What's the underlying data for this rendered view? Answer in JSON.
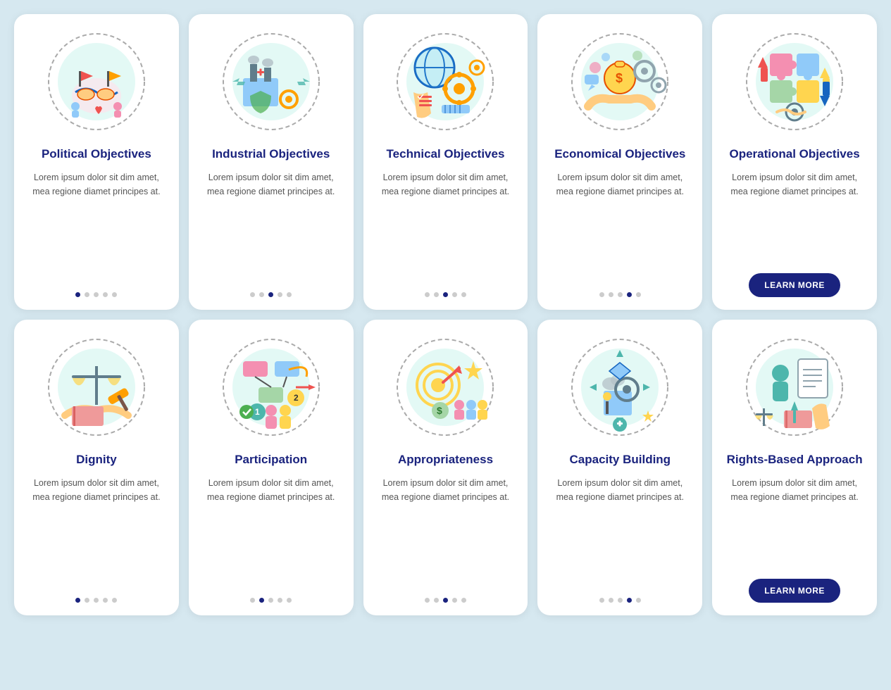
{
  "cards": [
    {
      "id": "political-objectives",
      "title": "Political Objectives",
      "body": "Lorem ipsum dolor sit dim amet, mea regione diamet principes at.",
      "dots": [
        1,
        0,
        0,
        0,
        0
      ],
      "hasButton": false,
      "icon": "political"
    },
    {
      "id": "industrial-objectives",
      "title": "Industrial Objectives",
      "body": "Lorem ipsum dolor sit dim amet, mea regione diamet principes at.",
      "dots": [
        0,
        0,
        1,
        0,
        0
      ],
      "hasButton": false,
      "icon": "industrial"
    },
    {
      "id": "technical-objectives",
      "title": "Technical Objectives",
      "body": "Lorem ipsum dolor sit dim amet, mea regione diamet principes at.",
      "dots": [
        0,
        0,
        1,
        0,
        0
      ],
      "hasButton": false,
      "icon": "technical"
    },
    {
      "id": "economical-objectives",
      "title": "Economical Objectives",
      "body": "Lorem ipsum dolor sit dim amet, mea regione diamet principes at.",
      "dots": [
        0,
        0,
        0,
        1,
        0
      ],
      "hasButton": false,
      "icon": "economical"
    },
    {
      "id": "operational-objectives",
      "title": "Operational Objectives",
      "body": "Lorem ipsum dolor sit dim amet, mea regione diamet principes at.",
      "dots": null,
      "hasButton": true,
      "buttonLabel": "LEARN MORE",
      "icon": "operational"
    },
    {
      "id": "dignity",
      "title": "Dignity",
      "body": "Lorem ipsum dolor sit dim amet, mea regione diamet principes at.",
      "dots": [
        1,
        0,
        0,
        0,
        0
      ],
      "hasButton": false,
      "icon": "dignity"
    },
    {
      "id": "participation",
      "title": "Participation",
      "body": "Lorem ipsum dolor sit dim amet, mea regione diamet principes at.",
      "dots": [
        0,
        1,
        0,
        0,
        0
      ],
      "hasButton": false,
      "icon": "participation"
    },
    {
      "id": "appropriateness",
      "title": "Appropriateness",
      "body": "Lorem ipsum dolor sit dim amet, mea regione diamet principes at.",
      "dots": [
        0,
        0,
        1,
        0,
        0
      ],
      "hasButton": false,
      "icon": "appropriateness"
    },
    {
      "id": "capacity-building",
      "title": "Capacity Building",
      "body": "Lorem ipsum dolor sit dim amet, mea regione diamet principes at.",
      "dots": [
        0,
        0,
        0,
        1,
        0
      ],
      "hasButton": false,
      "icon": "capacity"
    },
    {
      "id": "rights-based",
      "title": "Rights-Based Approach",
      "body": "Lorem ipsum dolor sit dim amet, mea regione diamet principes at.",
      "dots": null,
      "hasButton": true,
      "buttonLabel": "LEARN MORE",
      "icon": "rights"
    }
  ]
}
